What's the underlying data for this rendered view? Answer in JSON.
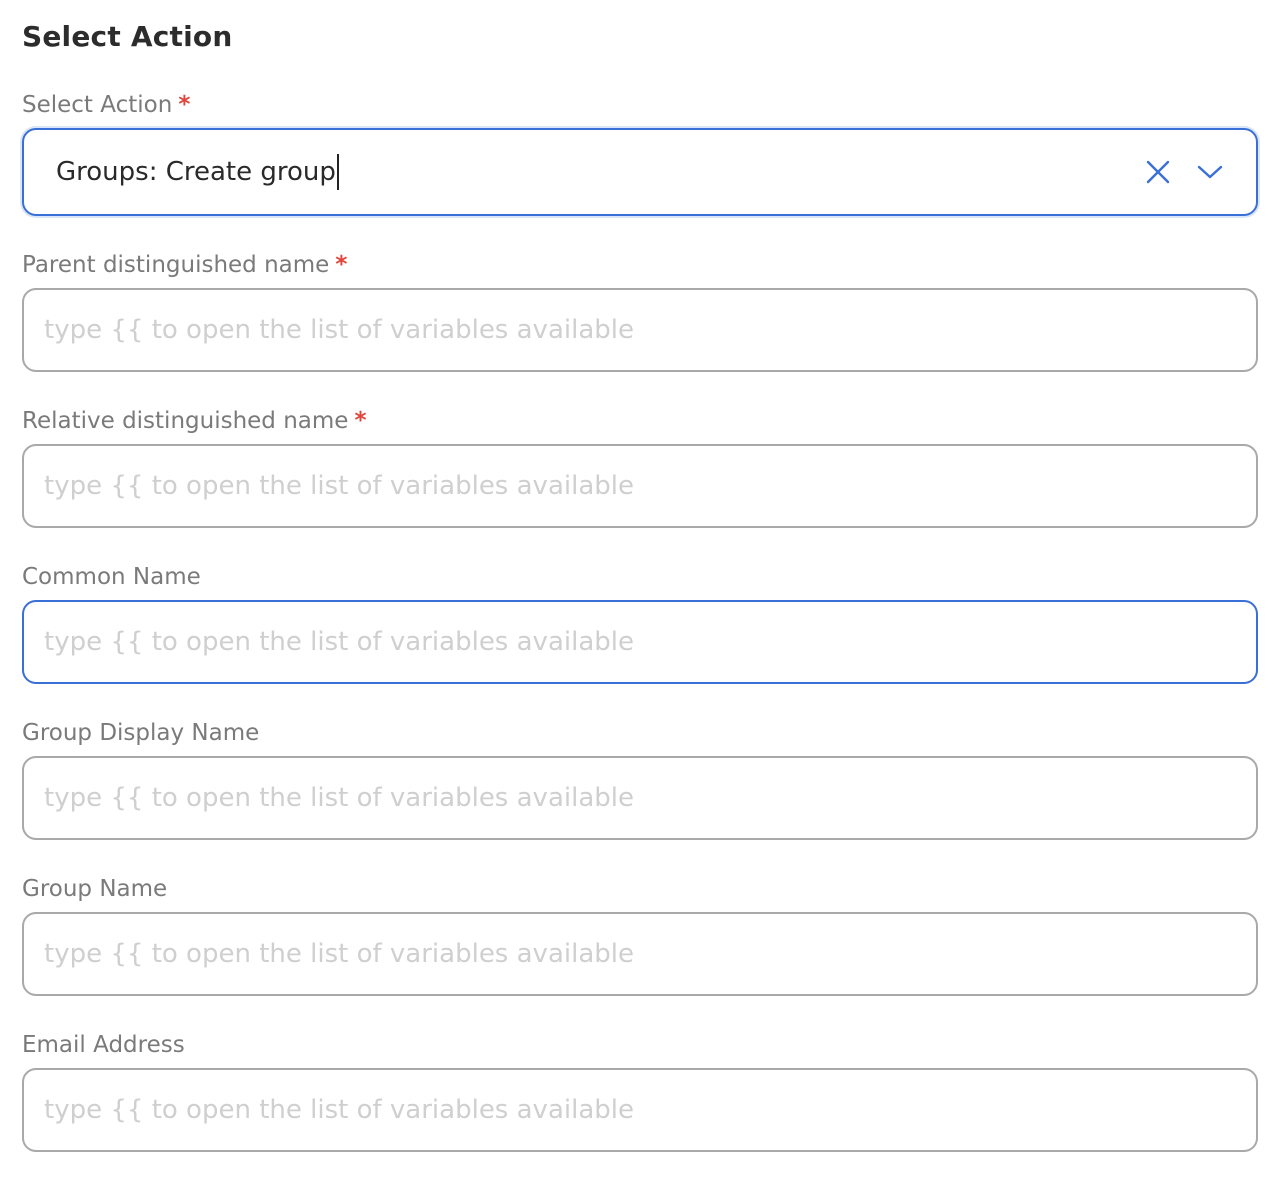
{
  "section": {
    "title": "Select Action"
  },
  "select_action": {
    "label": "Select Action",
    "required_mark": "*",
    "value": "Groups: Create group",
    "clear_icon": "close-icon",
    "dropdown_icon": "chevron-down-icon"
  },
  "fields": [
    {
      "label": "Parent distinguished name",
      "required_mark": "*",
      "placeholder": "type {{ to open the list of variables available",
      "value": ""
    },
    {
      "label": "Relative distinguished name",
      "required_mark": "*",
      "placeholder": "type {{ to open the list of variables available",
      "value": ""
    },
    {
      "label": "Common Name",
      "placeholder": "type {{ to open the list of variables available",
      "value": ""
    },
    {
      "label": "Group Display Name",
      "placeholder": "type {{ to open the list of variables available",
      "value": ""
    },
    {
      "label": "Group Name",
      "placeholder": "type {{ to open the list of variables available",
      "value": ""
    },
    {
      "label": "Email Address",
      "placeholder": "type {{ to open the list of variables available",
      "value": ""
    }
  ],
  "colors": {
    "accent": "#3a6fd8",
    "required": "#e0443a",
    "label": "#7a7a7a",
    "placeholder": "#cfcfcf",
    "border": "#a9a9a9"
  }
}
